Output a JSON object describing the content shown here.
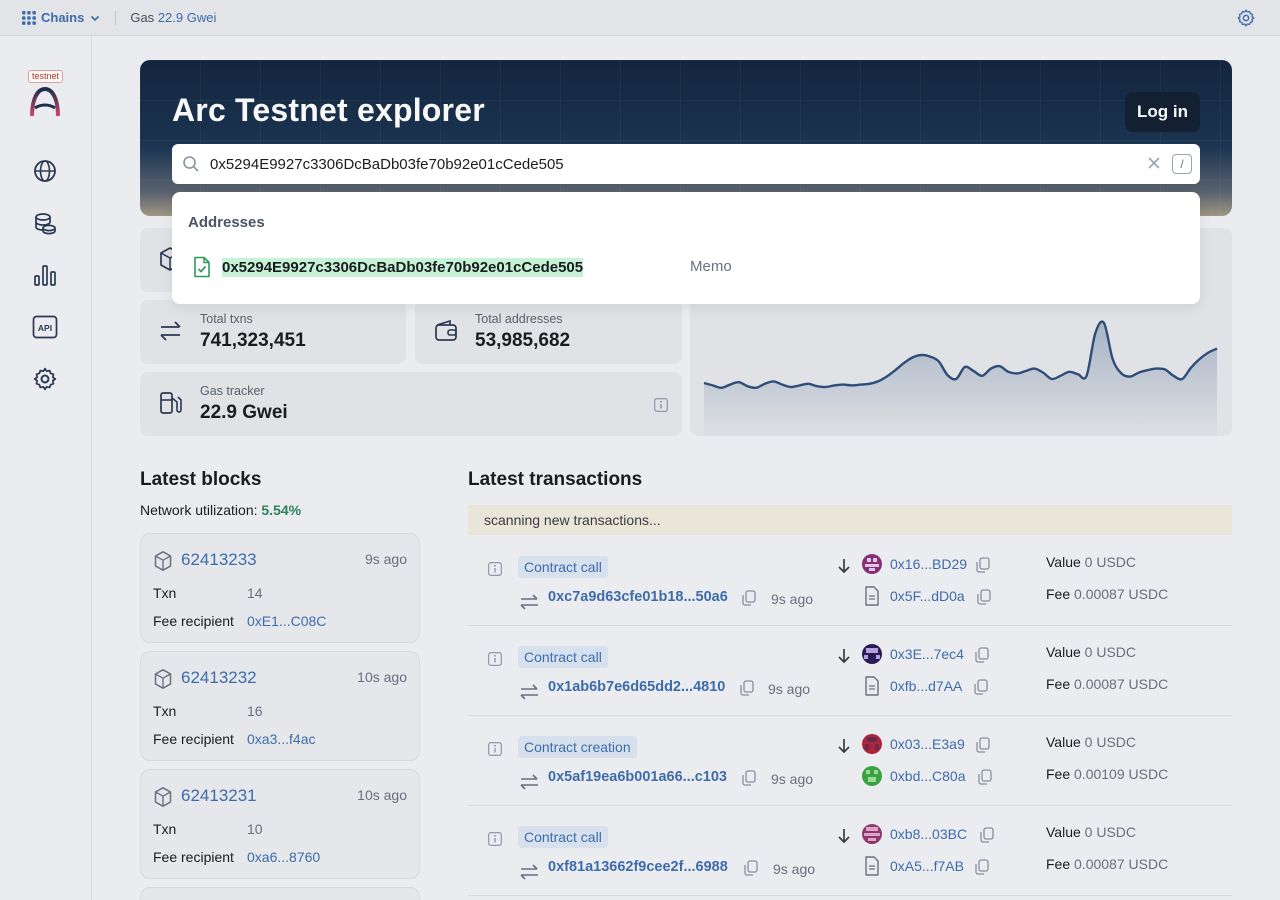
{
  "topbar": {
    "chains_label": "Chains",
    "gas_label": "Gas",
    "gas_value": "22.9 Gwei"
  },
  "sidebar": {
    "badge": "testnet",
    "api_label": "API"
  },
  "hero": {
    "title": "Arc Testnet explorer",
    "login_label": "Log in"
  },
  "search": {
    "query": "0x5294E9927c3306DcBaDb03fe70b92e01cCede505",
    "shortcut": "/"
  },
  "dropdown": {
    "heading": "Addresses",
    "result": {
      "address": "0x5294E9927c3306DcBaDb03fe70b92e01cCede505",
      "name": "Memo"
    }
  },
  "stats": {
    "total_txns": {
      "label": "Total txns",
      "value": "741,323,451"
    },
    "total_addresses": {
      "label": "Total addresses",
      "value": "53,985,682"
    },
    "gas_tracker": {
      "label": "Gas tracker",
      "value": "22.9 Gwei"
    }
  },
  "latest_blocks": {
    "title": "Latest blocks",
    "utilization_label": "Network utilization:",
    "utilization_value": "5.54%",
    "txn_label": "Txn",
    "fee_label": "Fee recipient",
    "items": [
      {
        "number": "62413233",
        "age": "9s ago",
        "txn": "14",
        "fee_recipient": "0xE1...C08C"
      },
      {
        "number": "62413232",
        "age": "10s ago",
        "txn": "16",
        "fee_recipient": "0xa3...f4ac"
      },
      {
        "number": "62413231",
        "age": "10s ago",
        "txn": "10",
        "fee_recipient": "0xa6...8760"
      }
    ]
  },
  "latest_transactions": {
    "title": "Latest transactions",
    "scanning": "scanning new transactions...",
    "value_label": "Value",
    "fee_label": "Fee",
    "items": [
      {
        "type": "Contract call",
        "hash": "0xc7a9d63cfe01b18...50a6",
        "age": "9s ago",
        "from": "0x16...BD29",
        "to": "0x5F...dD0a",
        "value": "0 USDC",
        "fee": "0.00087 USDC"
      },
      {
        "type": "Contract call",
        "hash": "0x1ab6b7e6d65dd2...4810",
        "age": "9s ago",
        "from": "0x3E...7ec4",
        "to": "0xfb...d7AA",
        "value": "0 USDC",
        "fee": "0.00087 USDC"
      },
      {
        "type": "Contract creation",
        "hash": "0x5af19ea6b001a66...c103",
        "age": "9s ago",
        "from": "0x03...E3a9",
        "to": "0xbd...C80a",
        "value": "0 USDC",
        "fee": "0.00109 USDC"
      },
      {
        "type": "Contract call",
        "hash": "0xf81a13662f9cee2f...6988",
        "age": "9s ago",
        "from": "0xb8...03BC",
        "to": "0xA5...f7AB",
        "value": "0 USDC",
        "fee": "0.00087 USDC"
      }
    ]
  },
  "chart_data": {
    "type": "area",
    "values": [
      0.25,
      0.22,
      0.19,
      0.23,
      0.26,
      0.21,
      0.19,
      0.24,
      0.27,
      0.23,
      0.2,
      0.22,
      0.24,
      0.21,
      0.2,
      0.22,
      0.23,
      0.22,
      0.23,
      0.24,
      0.27,
      0.33,
      0.41,
      0.5,
      0.57,
      0.6,
      0.58,
      0.52,
      0.35,
      0.3,
      0.45,
      0.4,
      0.34,
      0.43,
      0.46,
      0.39,
      0.37,
      0.4,
      0.43,
      0.38,
      0.3,
      0.34,
      0.39,
      0.36,
      0.34,
      0.87,
      1.0,
      0.55,
      0.37,
      0.33,
      0.38,
      0.41,
      0.43,
      0.42,
      0.34,
      0.3,
      0.44,
      0.55,
      0.63,
      0.68
    ],
    "grid": false
  }
}
